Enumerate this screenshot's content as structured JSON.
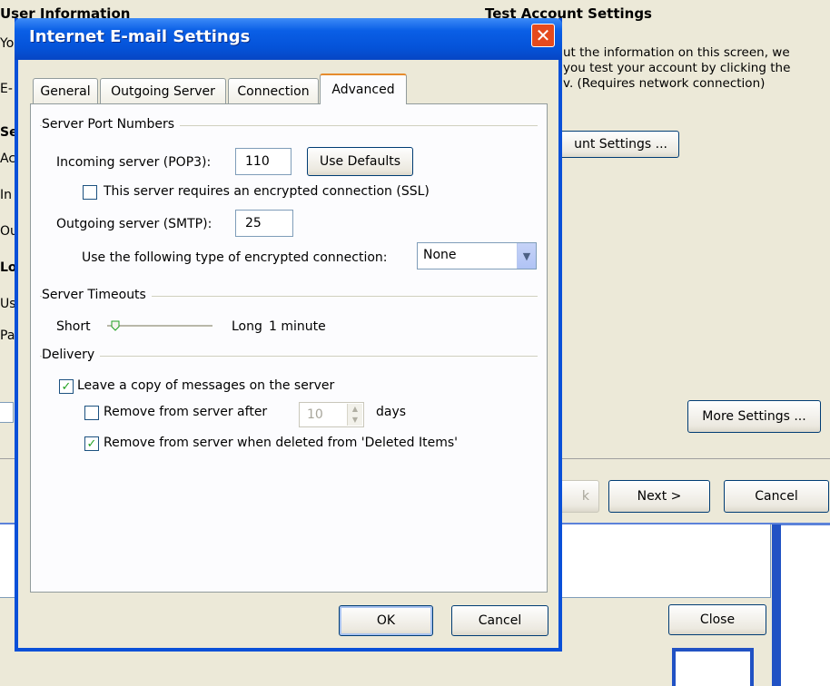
{
  "wizard": {
    "section_user_info": "User Information",
    "section_test_account": "Test Account Settings",
    "test_account_text": "ut the information on this screen, we\nyou test your account by clicking the\nv. (Requires network connection)",
    "test_account_button": "unt Settings ...",
    "more_settings_button": "More Settings ...",
    "back_button": "k",
    "next_button": "Next >",
    "cancel_button": "Cancel",
    "left_fragments": [
      "Yo",
      "E-",
      "Se",
      "Ac",
      "In",
      "Ou",
      "Lo",
      "Us",
      "Pa"
    ]
  },
  "second_panel": {
    "close_button": "Close"
  },
  "dialog": {
    "title": "Internet E-mail Settings",
    "close_glyph": "✕",
    "tabs": [
      {
        "label": "General"
      },
      {
        "label": "Outgoing Server"
      },
      {
        "label": "Connection"
      },
      {
        "label": "Advanced"
      }
    ],
    "server_ports": {
      "group_label": "Server Port Numbers",
      "incoming_label": "Incoming server (POP3):",
      "incoming_value": "110",
      "use_defaults_button": "Use Defaults",
      "ssl_checkbox_label": "This server requires an encrypted connection (SSL)",
      "ssl_checked": false,
      "outgoing_label": "Outgoing server (SMTP):",
      "outgoing_value": "25",
      "encryption_label": "Use the following type of encrypted connection:",
      "encryption_value": "None"
    },
    "timeouts": {
      "group_label": "Server Timeouts",
      "short_label": "Short",
      "long_label": "Long",
      "value_label": "1 minute"
    },
    "delivery": {
      "group_label": "Delivery",
      "leave_copy_label": "Leave a copy of messages on the server",
      "leave_copy_checked": true,
      "remove_after_label": "Remove from server after",
      "remove_after_checked": false,
      "remove_after_days": "10",
      "days_label": "days",
      "remove_deleted_label": "Remove from server when deleted from 'Deleted Items'",
      "remove_deleted_checked": true
    },
    "ok_button": "OK",
    "cancel_button": "Cancel"
  },
  "colors": {
    "titlebar": "#0553d9",
    "dialog_bg": "#ece9d8",
    "close_red": "#e54a1d",
    "active_tab_accent": "#e68b2c"
  }
}
